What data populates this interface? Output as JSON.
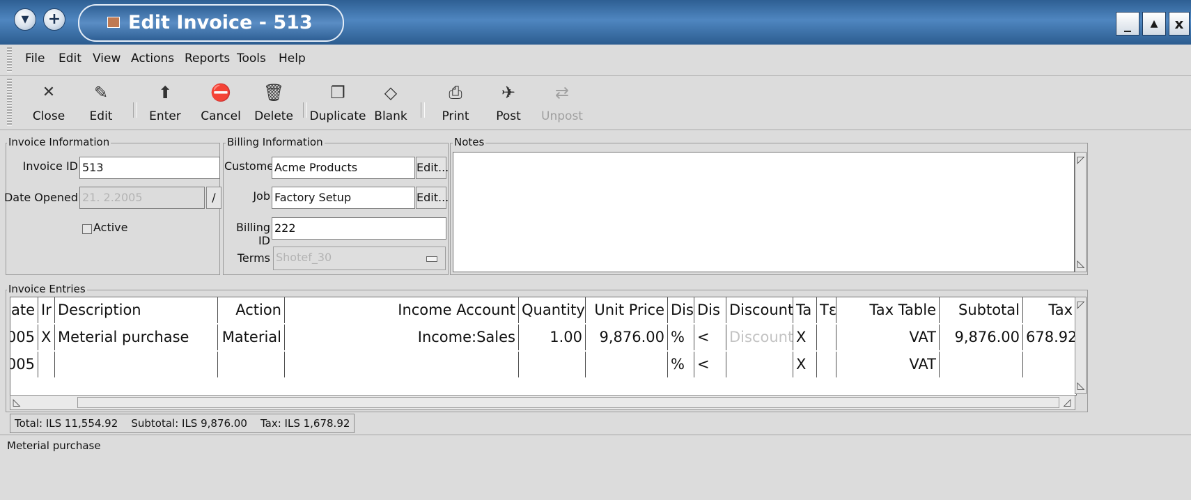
{
  "window": {
    "title": "Edit Invoice - 513",
    "title_icon": "invoice-icon",
    "left_buttons": [
      "menu-down-icon",
      "add-icon"
    ],
    "controls": [
      {
        "name": "minimize",
        "glyph": "_"
      },
      {
        "name": "maximize",
        "glyph": "▲"
      },
      {
        "name": "close",
        "glyph": "x"
      }
    ]
  },
  "menu": [
    "File",
    "Edit",
    "View",
    "Actions",
    "Reports",
    "Tools",
    "Help"
  ],
  "toolbar": {
    "close": "Close",
    "edit": "Edit",
    "enter": "Enter",
    "cancel": "Cancel",
    "delete": "Delete",
    "duplicate": "Duplicate",
    "blank": "Blank",
    "print": "Print",
    "post": "Post",
    "unpost": "Unpost"
  },
  "invoice_info": {
    "legend": "Invoice Information",
    "invoice_id_label": "Invoice ID",
    "invoice_id": "513",
    "date_label": "Date Opened",
    "date": "21. 2.2005",
    "date_btn": "/",
    "active_label": "Active"
  },
  "billing": {
    "legend": "Billing Information",
    "customer_label": "Customer",
    "customer": "Acme Products",
    "job_label": "Job",
    "job": "Factory Setup",
    "billing_id_label": "Billing ID",
    "billing_id": "222",
    "terms_label": "Terms",
    "terms": "Shotef_30",
    "edit_btn": "Edit..."
  },
  "notes": {
    "legend": "Notes"
  },
  "entries": {
    "legend": "Invoice Entries",
    "columns": [
      "ate",
      "Ir",
      "Description",
      "Action",
      "Income Account",
      "Quantity",
      "Unit Price",
      "Dis",
      "Dis",
      "Discount",
      "Ta",
      "Tɛ",
      "Tax Table",
      "Subtotal",
      "Tax"
    ],
    "rows": [
      {
        "date": "005",
        "inv": "X",
        "description": "Meterial purchase",
        "action": "Material",
        "account": "Income:Sales",
        "quantity": "1.00",
        "unit_price": "9,876.00",
        "dis_type": "%",
        "dis_how": "<",
        "discount": "Discount",
        "taxable": "X",
        "tax_incl": "",
        "tax_table": "VAT",
        "subtotal": "9,876.00",
        "tax": "678.92"
      },
      {
        "date": "005",
        "inv": "",
        "description": "",
        "action": "",
        "account": "",
        "quantity": "",
        "unit_price": "",
        "dis_type": "%",
        "dis_how": "<",
        "discount": "",
        "taxable": "X",
        "tax_incl": "",
        "tax_table": "VAT",
        "subtotal": "",
        "tax": ""
      }
    ]
  },
  "totals": {
    "total": "Total: ILS 11,554.92",
    "subtotal": "Subtotal: ILS 9,876.00",
    "tax": "Tax: ILS 1,678.92"
  },
  "status": "Meterial purchase"
}
